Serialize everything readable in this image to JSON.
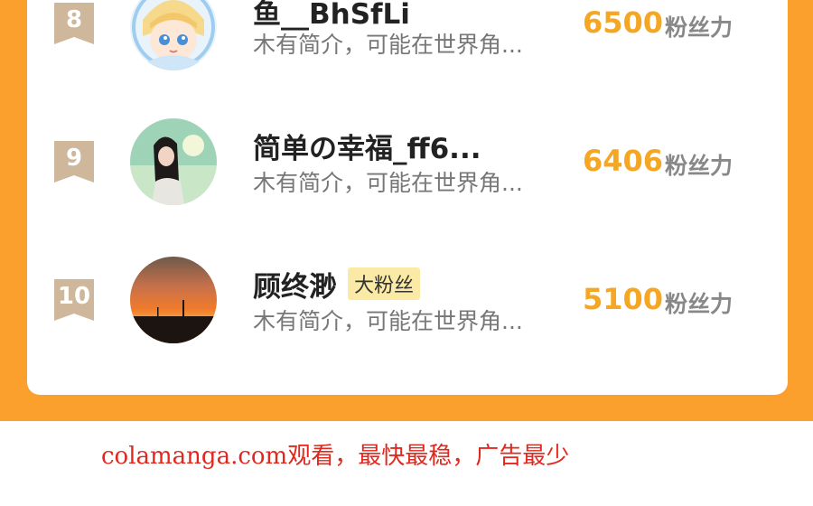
{
  "ranking": {
    "items": [
      {
        "rank": "8",
        "name": "鱼__BhSfLi",
        "intro": "木有简介，可能在世界角...",
        "score": "6500",
        "score_unit": "粉丝力",
        "badge": "",
        "avatar_icon": "anime-character-avatar"
      },
      {
        "rank": "9",
        "name": "简单の幸福_ff6...",
        "intro": "木有简介，可能在世界角...",
        "score": "6406",
        "score_unit": "粉丝力",
        "badge": "",
        "avatar_icon": "girl-photo-avatar"
      },
      {
        "rank": "10",
        "name": "顾终渺",
        "intro": "木有简介，可能在世界角...",
        "score": "5100",
        "score_unit": "粉丝力",
        "badge": "大粉丝",
        "avatar_icon": "sunset-photo-avatar"
      }
    ]
  },
  "footer": {
    "watermark": "colamanga.com观看，最快最稳，广告最少"
  },
  "colors": {
    "accent_orange": "#fba02d",
    "score_color": "#f5a623",
    "badge_bg": "#fbeaa6",
    "footer_red": "#e0281e"
  }
}
